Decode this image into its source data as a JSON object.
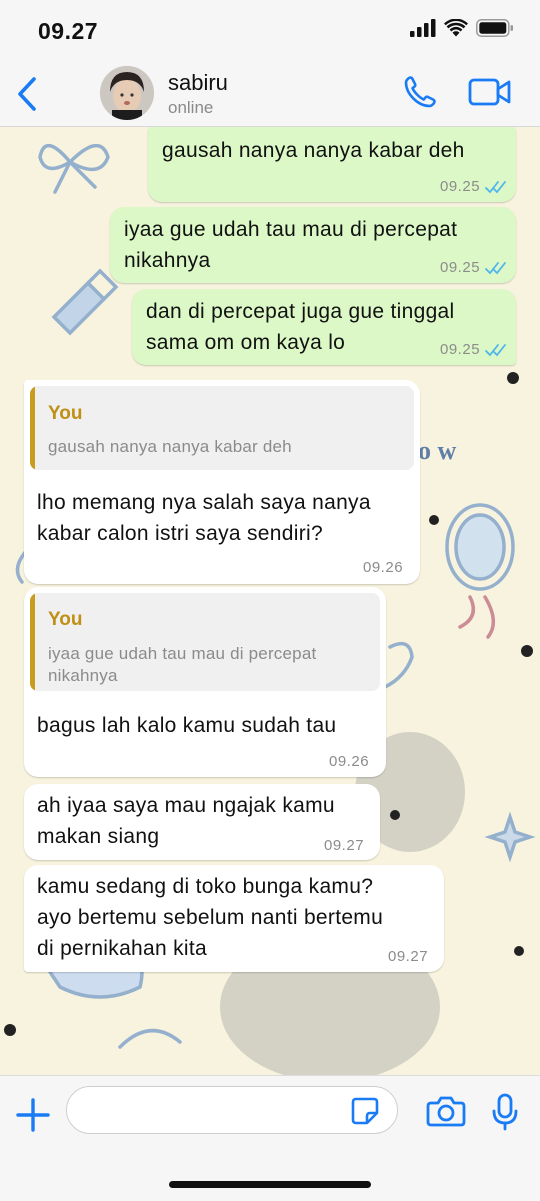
{
  "status_bar": {
    "time": "09.27"
  },
  "header": {
    "contact_name": "sabiru",
    "contact_status": "online"
  },
  "messages": [
    {
      "direction": "outgoing",
      "text": "gausah nanya nanya kabar deh",
      "time": "09.25",
      "read": true
    },
    {
      "direction": "outgoing",
      "lines": [
        "iyaa gue udah tau mau di percepat",
        "nikahnya"
      ],
      "time": "09.25",
      "read": true
    },
    {
      "direction": "outgoing",
      "lines": [
        "dan di percepat juga gue tinggal",
        "sama om om kaya lo"
      ],
      "time": "09.25",
      "read": true
    },
    {
      "direction": "incoming",
      "quote": {
        "author": "You",
        "text": "gausah nanya nanya kabar deh"
      },
      "lines": [
        "lho memang nya salah saya nanya",
        "kabar calon istri saya sendiri?"
      ],
      "time": "09.26"
    },
    {
      "direction": "incoming",
      "quote": {
        "author": "You",
        "lines": [
          "iyaa gue udah tau mau di percepat",
          "nikahnya"
        ]
      },
      "text": "bagus lah kalo kamu sudah tau",
      "time": "09.26"
    },
    {
      "direction": "incoming",
      "lines": [
        "ah iyaa saya mau ngajak kamu",
        "makan siang"
      ],
      "time": "09.27"
    },
    {
      "direction": "incoming",
      "lines": [
        "kamu sedang di toko bunga kamu?",
        "ayo bertemu sebelum nanti bertemu",
        "di pernikahan kita"
      ],
      "time": "09.27"
    }
  ],
  "composer": {
    "value": "",
    "placeholder": ""
  },
  "colors": {
    "accent": "#1a7cf5",
    "outgoing_bubble": "#dbf8c6",
    "incoming_bubble": "#ffffff",
    "quote_author": "#c08f15",
    "wallpaper": "#f7f3de",
    "read_ticks": "#4fb6ec"
  },
  "icons": [
    "signal-icon",
    "wifi-icon",
    "battery-icon",
    "back-chevron-icon",
    "phone-icon",
    "video-camera-icon",
    "plus-icon",
    "sticker-icon",
    "camera-icon",
    "microphone-icon",
    "double-check-icon"
  ]
}
